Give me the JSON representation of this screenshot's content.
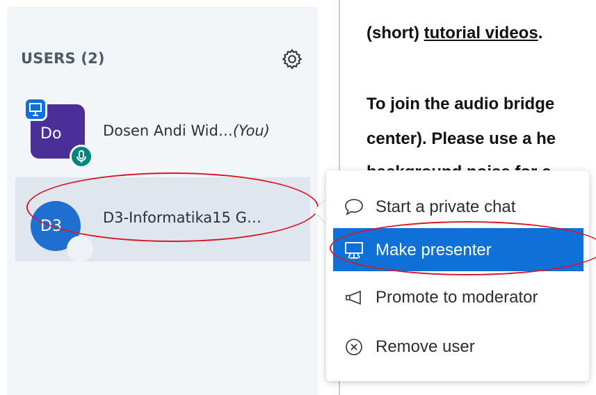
{
  "users_panel": {
    "header": "USERS (2)",
    "users": [
      {
        "initials": "Do",
        "name": "Dosen Andi Wid…",
        "tag": "(You)"
      },
      {
        "initials": "D3",
        "name": "D3-Informatika15 G…"
      }
    ]
  },
  "presentation": {
    "line_prefix": "(short) ",
    "link": "tutorial videos",
    "line_suffix": ".",
    "para_line1": "To join the audio bridge",
    "para_line2a": "center). ",
    "para_line2b": "Please use a he",
    "para_line3": "background noise for c"
  },
  "context_menu": {
    "items": [
      {
        "label": "Start a private chat",
        "icon": "chat-bubble-icon"
      },
      {
        "label": "Make presenter",
        "icon": "presenter-screen-icon"
      },
      {
        "label": "Promote to moderator",
        "icon": "megaphone-icon"
      },
      {
        "label": "Remove user",
        "icon": "remove-circle-icon"
      }
    ]
  },
  "colors": {
    "accent": "#0f70d7",
    "annotation_red": "#d8182a",
    "avatar_me": "#4a2f99",
    "avatar_other": "#1f6fd1"
  }
}
